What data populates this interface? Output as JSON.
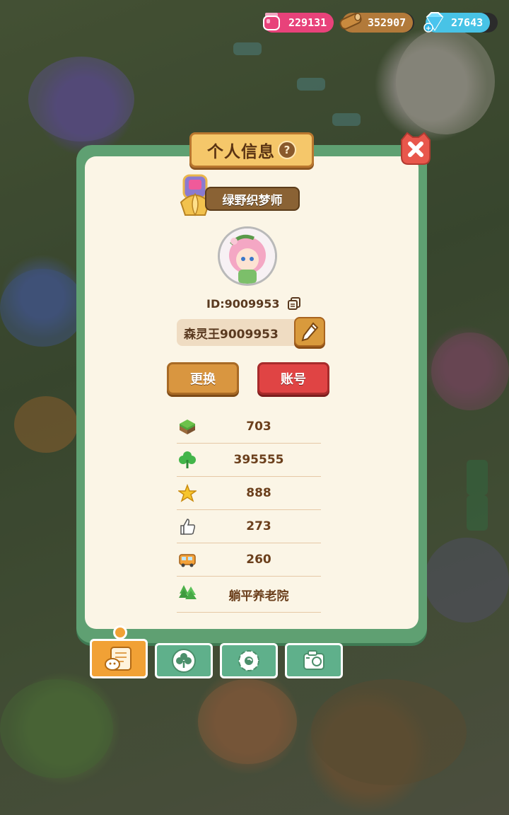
{
  "currencies": [
    {
      "name": "potion",
      "icon": "pink-potion-icon",
      "value": "229131",
      "color": "#e8427a"
    },
    {
      "name": "wood",
      "icon": "wood-log-icon",
      "value": "352907",
      "color": "#c98a3e"
    },
    {
      "name": "diamond",
      "icon": "diamond-icon",
      "value": "27643",
      "color": "#5fd0f0"
    }
  ],
  "panel": {
    "title": "个人信息",
    "help_glyph": "?"
  },
  "profile": {
    "rank_title": "绿野织梦师",
    "player_id": "ID:9009953",
    "nickname": "森灵王9009953"
  },
  "buttons": {
    "switch_label": "更换",
    "account_label": "账号"
  },
  "stats": [
    {
      "icon": "grass-block-icon",
      "value": "703"
    },
    {
      "icon": "clover-icon",
      "value": "395555"
    },
    {
      "icon": "star-icon",
      "value": "888"
    },
    {
      "icon": "thumbs-up-icon",
      "value": "273"
    },
    {
      "icon": "bus-icon",
      "value": "260"
    },
    {
      "icon": "trees-icon",
      "value": "躺平养老院"
    }
  ],
  "tabs": [
    {
      "icon": "profile-card-icon",
      "active": true
    },
    {
      "icon": "clover-badge-icon",
      "active": false
    },
    {
      "icon": "gear-flower-icon",
      "active": false
    },
    {
      "icon": "camera-icon",
      "active": false
    }
  ],
  "colors": {
    "panel_frame": "#5fa072",
    "panel_body": "#fbf5e6",
    "switch_button": "#d99640",
    "account_button": "#e04444",
    "active_tab": "#f1a135",
    "inactive_tab": "#5fb08b"
  }
}
